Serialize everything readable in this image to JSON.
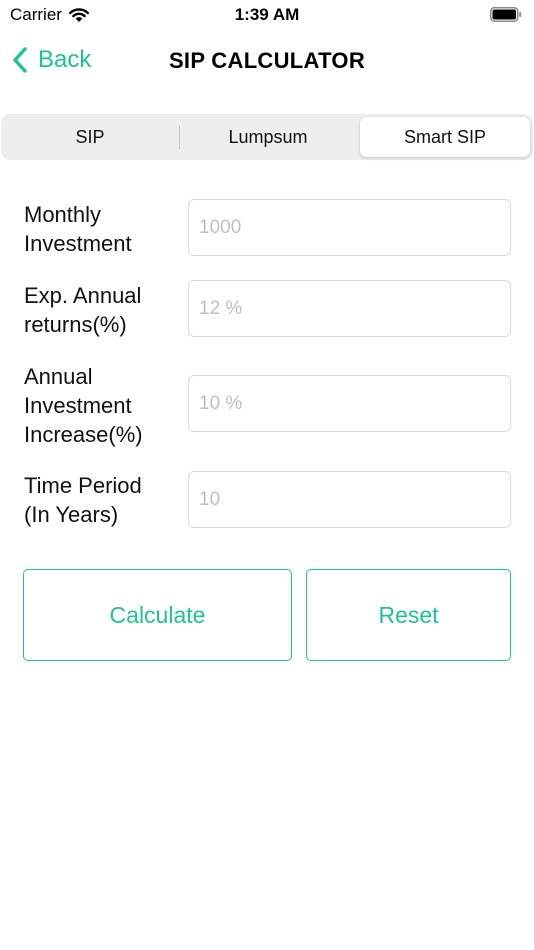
{
  "colors": {
    "accent": "#1bc68f",
    "placeholder": "#c0c0c0",
    "segment_bg": "#eeeeef"
  },
  "status_bar": {
    "carrier": "Carrier",
    "time": "1:39 AM",
    "wifi_icon": "wifi-icon",
    "battery_icon": "battery-icon"
  },
  "nav": {
    "back_label": "Back",
    "title": "SIP CALCULATOR",
    "back_icon": "chevron-left-icon"
  },
  "tabs": [
    {
      "label": "SIP",
      "selected": false
    },
    {
      "label": "Lumpsum",
      "selected": false
    },
    {
      "label": "Smart SIP",
      "selected": true
    }
  ],
  "form": {
    "fields": [
      {
        "label_line1": "Monthly",
        "label_line2": "Investment",
        "placeholder": "1000"
      },
      {
        "label_line1": "Exp. Annual",
        "label_line2": "returns(%)",
        "placeholder": "12 %"
      },
      {
        "label_line1": "Annual",
        "label_line2": "Investment",
        "label_line3": "Increase(%)",
        "placeholder": "10 %"
      },
      {
        "label_line1": "Time Period",
        "label_line2": "(In Years)",
        "placeholder": "10"
      }
    ]
  },
  "buttons": {
    "calculate": "Calculate",
    "reset": "Reset"
  }
}
